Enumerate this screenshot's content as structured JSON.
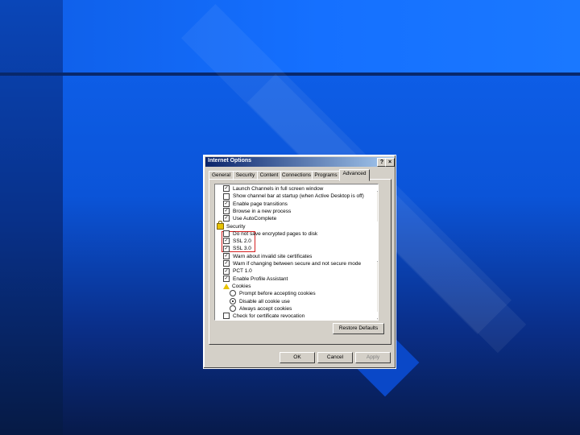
{
  "window": {
    "title": "Internet Options",
    "help_btn": "?",
    "close_btn": "×"
  },
  "tabs": [
    "General",
    "Security",
    "Content",
    "Connections",
    "Programs",
    "Advanced"
  ],
  "active_tab": "Advanced",
  "settings": [
    {
      "type": "checkbox",
      "checked": true,
      "label": "Launch Channels in full screen window",
      "indent": 1
    },
    {
      "type": "checkbox",
      "checked": false,
      "label": "Show channel bar at startup (when Active Desktop is off)",
      "indent": 1
    },
    {
      "type": "checkbox",
      "checked": true,
      "label": "Enable page transitions",
      "indent": 1
    },
    {
      "type": "checkbox",
      "checked": true,
      "label": "Browse in a new process",
      "indent": 1
    },
    {
      "type": "checkbox",
      "checked": true,
      "label": "Use AutoComplete",
      "indent": 1
    },
    {
      "type": "header",
      "icon": "lock",
      "label": "Security",
      "indent": 0
    },
    {
      "type": "checkbox",
      "checked": false,
      "label": "Do not save encrypted pages to disk",
      "indent": 1
    },
    {
      "type": "checkbox",
      "checked": true,
      "label": "SSL 2.0",
      "indent": 1
    },
    {
      "type": "checkbox",
      "checked": true,
      "label": "SSL 3.0",
      "indent": 1
    },
    {
      "type": "checkbox",
      "checked": true,
      "label": "Warn about invalid site certificates",
      "indent": 1
    },
    {
      "type": "checkbox",
      "checked": true,
      "label": "Warn if changing between secure and not secure mode",
      "indent": 1
    },
    {
      "type": "checkbox",
      "checked": true,
      "label": "PCT 1.0",
      "indent": 1
    },
    {
      "type": "checkbox",
      "checked": true,
      "label": "Enable Profile Assistant",
      "indent": 1
    },
    {
      "type": "header",
      "icon": "warning",
      "label": "Cookies",
      "indent": 1
    },
    {
      "type": "radio",
      "checked": false,
      "label": "Prompt before accepting cookies",
      "indent": 2
    },
    {
      "type": "radio",
      "checked": true,
      "label": "Disable all cookie use",
      "indent": 2
    },
    {
      "type": "radio",
      "checked": false,
      "label": "Always accept cookies",
      "indent": 2
    },
    {
      "type": "checkbox",
      "checked": false,
      "label": "Check for certificate revocation",
      "indent": 1
    }
  ],
  "buttons": {
    "restore_defaults": "Restore Defaults",
    "ok": "OK",
    "cancel": "Cancel",
    "apply": "Apply"
  },
  "colors": {
    "titlebar_start": "#0a246a",
    "highlight_box": "#d42020",
    "background_blue": "#0f63ef"
  }
}
